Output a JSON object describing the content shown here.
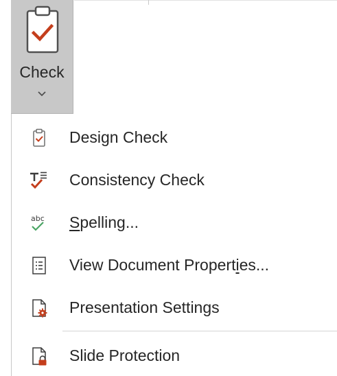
{
  "check_button": {
    "label": "Check",
    "icon": "clipboard-check-icon",
    "dropdown_icon": "chevron-down-icon"
  },
  "menu": {
    "items": [
      {
        "label": "Design Check",
        "icon": "clipboard-check-icon"
      },
      {
        "label": "Consistency Check",
        "icon": "text-check-icon"
      },
      {
        "label": "Spelling...",
        "icon": "abc-check-icon",
        "access_key": "S"
      },
      {
        "label": "View Document Properties...",
        "icon": "document-properties-icon",
        "access_key": "i"
      },
      {
        "label": "Presentation Settings",
        "icon": "document-gear-icon"
      },
      {
        "label": "Slide Protection",
        "icon": "document-lock-icon"
      }
    ]
  },
  "colors": {
    "accent_red": "#c43e1c",
    "check_green": "#4aa564",
    "button_selected_bg": "#c8c8c8",
    "text": "#262626"
  }
}
